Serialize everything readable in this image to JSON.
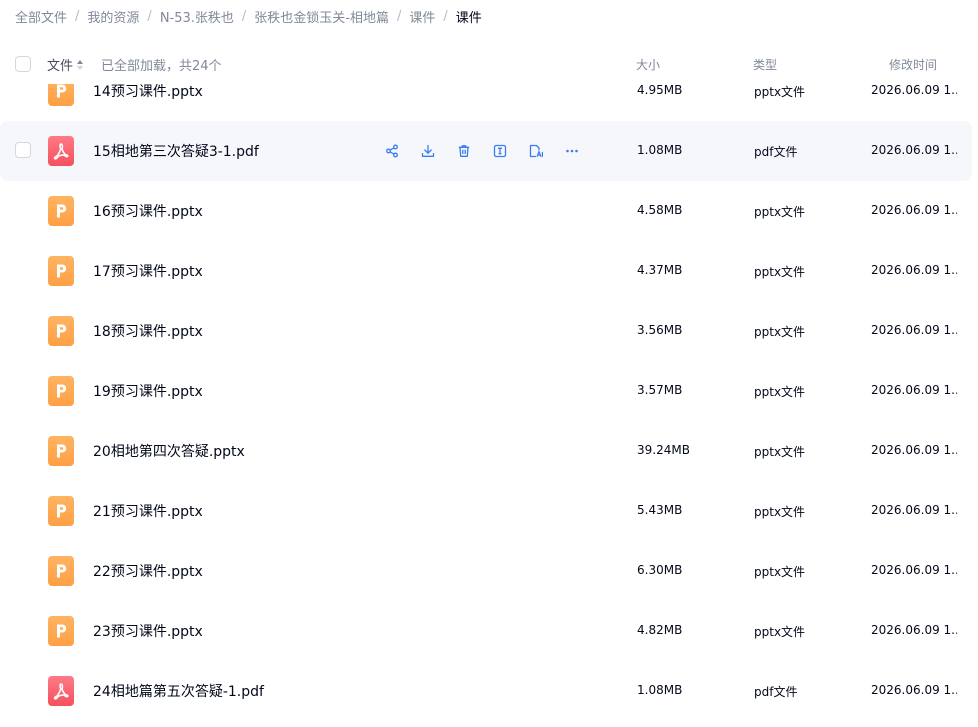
{
  "breadcrumb": {
    "items": [
      "全部文件",
      "我的资源",
      "N-53.张秩也",
      "张秩也金锁玉关-相地篇",
      "课件",
      "课件"
    ],
    "separator": "/"
  },
  "header": {
    "name_label": "文件",
    "loaded_text": "已全部加载，共24个",
    "size_label": "大小",
    "type_label": "类型",
    "time_label": "修改时间"
  },
  "colors": {
    "accent": "#3b7df0",
    "pptx_icon": "#ff9f45",
    "pdf_icon": "#f6505e",
    "hover_row": "#f5f7fb"
  },
  "row_actions": [
    "share-icon",
    "download-icon",
    "delete-icon",
    "rename-icon",
    "ai-icon",
    "more-icon"
  ],
  "files": [
    {
      "name": "14预习课件.pptx",
      "size": "4.95MB",
      "type": "pptx文件",
      "time": "2026.06.09 1...",
      "kind": "pptx"
    },
    {
      "name": "15相地第三次答疑3-1.pdf",
      "size": "1.08MB",
      "type": "pdf文件",
      "time": "2026.06.09 1...",
      "kind": "pdf",
      "hover": true
    },
    {
      "name": "16预习课件.pptx",
      "size": "4.58MB",
      "type": "pptx文件",
      "time": "2026.06.09 1...",
      "kind": "pptx"
    },
    {
      "name": "17预习课件.pptx",
      "size": "4.37MB",
      "type": "pptx文件",
      "time": "2026.06.09 1...",
      "kind": "pptx"
    },
    {
      "name": "18预习课件.pptx",
      "size": "3.56MB",
      "type": "pptx文件",
      "time": "2026.06.09 1...",
      "kind": "pptx"
    },
    {
      "name": "19预习课件.pptx",
      "size": "3.57MB",
      "type": "pptx文件",
      "time": "2026.06.09 1...",
      "kind": "pptx"
    },
    {
      "name": "20相地第四次答疑.pptx",
      "size": "39.24MB",
      "type": "pptx文件",
      "time": "2026.06.09 1...",
      "kind": "pptx"
    },
    {
      "name": "21预习课件.pptx",
      "size": "5.43MB",
      "type": "pptx文件",
      "time": "2026.06.09 1...",
      "kind": "pptx"
    },
    {
      "name": "22预习课件.pptx",
      "size": "6.30MB",
      "type": "pptx文件",
      "time": "2026.06.09 1...",
      "kind": "pptx"
    },
    {
      "name": "23预习课件.pptx",
      "size": "4.82MB",
      "type": "pptx文件",
      "time": "2026.06.09 1...",
      "kind": "pptx"
    },
    {
      "name": "24相地篇第五次答疑-1.pdf",
      "size": "1.08MB",
      "type": "pdf文件",
      "time": "2026.06.09 1...",
      "kind": "pdf"
    }
  ]
}
